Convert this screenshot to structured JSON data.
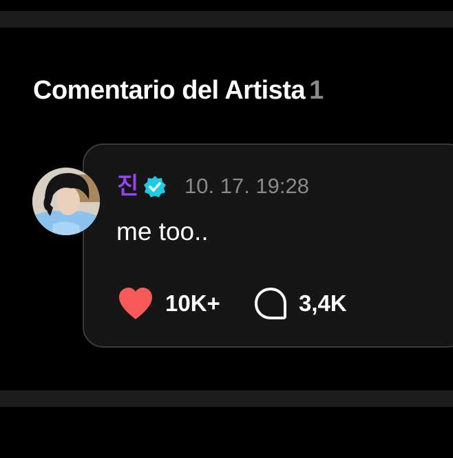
{
  "section": {
    "title": "Comentario del Artista",
    "count": "1"
  },
  "comment": {
    "author": "진",
    "verified_icon": "verified-badge-icon",
    "timestamp": "10. 17. 19:28",
    "text": "me too..",
    "likes": "10K+",
    "replies": "3,4K",
    "like_icon": "heart-icon",
    "reply_icon": "speech-bubble-icon"
  },
  "colors": {
    "author": "#9146f0",
    "verified": "#1ecbe1",
    "heart": "#f85a5a",
    "muted": "#8a8a8a",
    "bubble": "#161616"
  }
}
